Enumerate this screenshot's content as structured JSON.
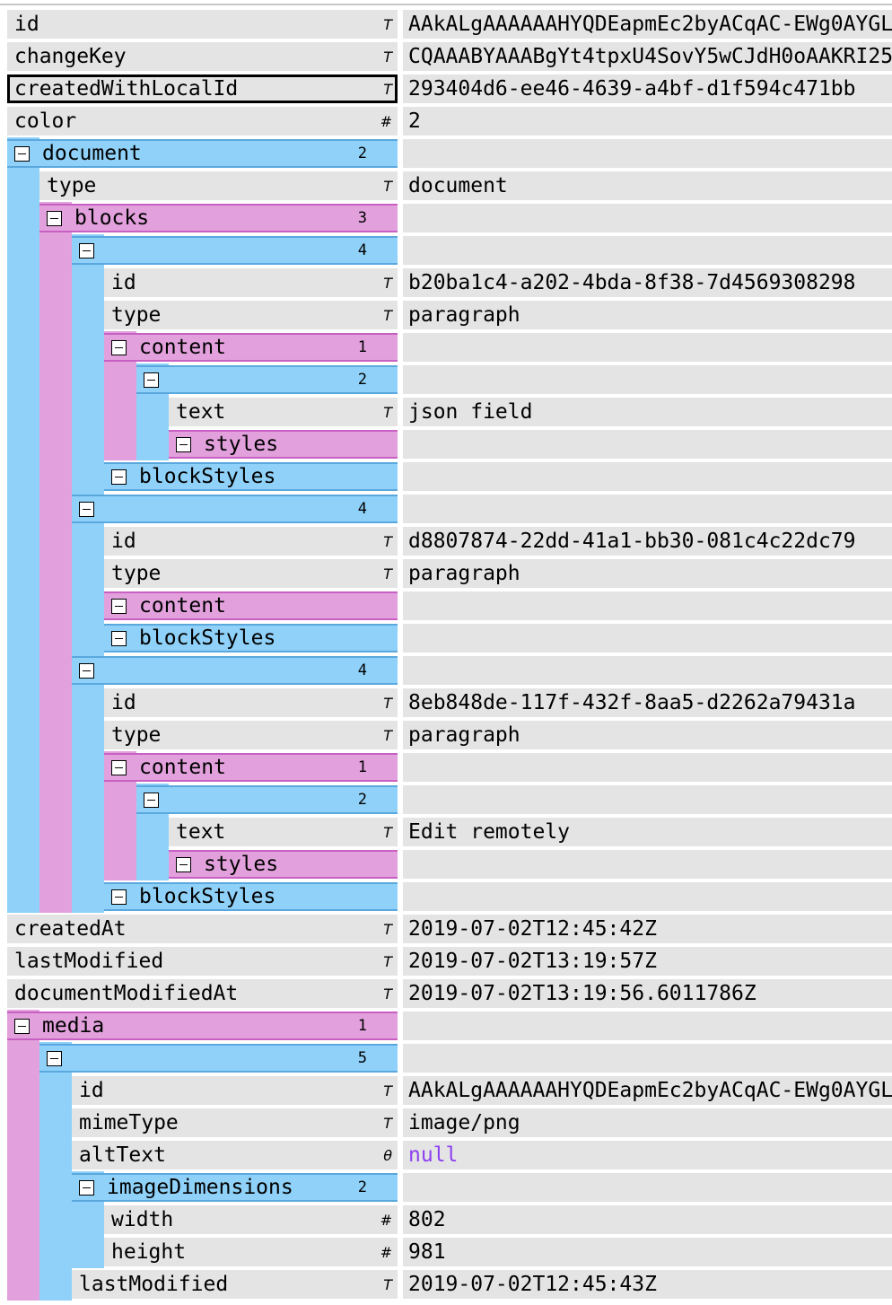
{
  "rows": [
    {
      "name": "id",
      "type": "T",
      "value": "AAkALgAAAAAAHYQDEapmEc2byACqAC-EWg0AYGL"
    },
    {
      "name": "changeKey",
      "type": "T",
      "value": "CQAAABYAAABgYt4tpxU4SovY5wCJdH0oAAKRI25"
    },
    {
      "name": "createdWithLocalId",
      "type": "T",
      "value": "293404d6-ee46-4639-a4bf-d1f594c471bb"
    },
    {
      "name": "color",
      "type": "#",
      "value": "2"
    },
    {
      "name": "document",
      "count": "2"
    },
    {
      "name": "type",
      "type": "T",
      "value": "document"
    },
    {
      "name": "blocks",
      "count": "3"
    },
    {
      "name": "",
      "count": "4"
    },
    {
      "name": "id",
      "type": "T",
      "value": "b20ba1c4-a202-4bda-8f38-7d4569308298"
    },
    {
      "name": "type",
      "type": "T",
      "value": "paragraph"
    },
    {
      "name": "content",
      "count": "1"
    },
    {
      "name": "",
      "count": "2"
    },
    {
      "name": "text",
      "type": "T",
      "value": "json field"
    },
    {
      "name": "styles"
    },
    {
      "name": "blockStyles"
    },
    {
      "name": "",
      "count": "4"
    },
    {
      "name": "id",
      "type": "T",
      "value": "d8807874-22dd-41a1-bb30-081c4c22dc79"
    },
    {
      "name": "type",
      "type": "T",
      "value": "paragraph"
    },
    {
      "name": "content"
    },
    {
      "name": "blockStyles"
    },
    {
      "name": "",
      "count": "4"
    },
    {
      "name": "id",
      "type": "T",
      "value": "8eb848de-117f-432f-8aa5-d2262a79431a"
    },
    {
      "name": "type",
      "type": "T",
      "value": "paragraph"
    },
    {
      "name": "content",
      "count": "1"
    },
    {
      "name": "",
      "count": "2"
    },
    {
      "name": "text",
      "type": "T",
      "value": "Edit remotely"
    },
    {
      "name": "styles"
    },
    {
      "name": "blockStyles"
    },
    {
      "name": "createdAt",
      "type": "T",
      "value": "2019-07-02T12:45:42Z"
    },
    {
      "name": "lastModified",
      "type": "T",
      "value": "2019-07-02T13:19:57Z"
    },
    {
      "name": "documentModifiedAt",
      "type": "T",
      "value": "2019-07-02T13:19:56.6011786Z"
    },
    {
      "name": "media",
      "count": "1"
    },
    {
      "name": "",
      "count": "5"
    },
    {
      "name": "id",
      "type": "T",
      "value": "AAkALgAAAAAAHYQDEapmEc2byACqAC-EWg0AYGL"
    },
    {
      "name": "mimeType",
      "type": "T",
      "value": "image/png"
    },
    {
      "name": "altText",
      "type": "0",
      "value": "null"
    },
    {
      "name": "imageDimensions",
      "count": "2"
    },
    {
      "name": "width",
      "type": "#",
      "value": "802"
    },
    {
      "name": "height",
      "type": "#",
      "value": "981"
    },
    {
      "name": "lastModified",
      "type": "T",
      "value": "2019-07-02T12:45:43Z"
    }
  ],
  "colors": {
    "object": "#8fd1f8",
    "array": "#e2a1dc",
    "leaf": "#e4e4e4",
    "null": "#8c3ff0"
  }
}
